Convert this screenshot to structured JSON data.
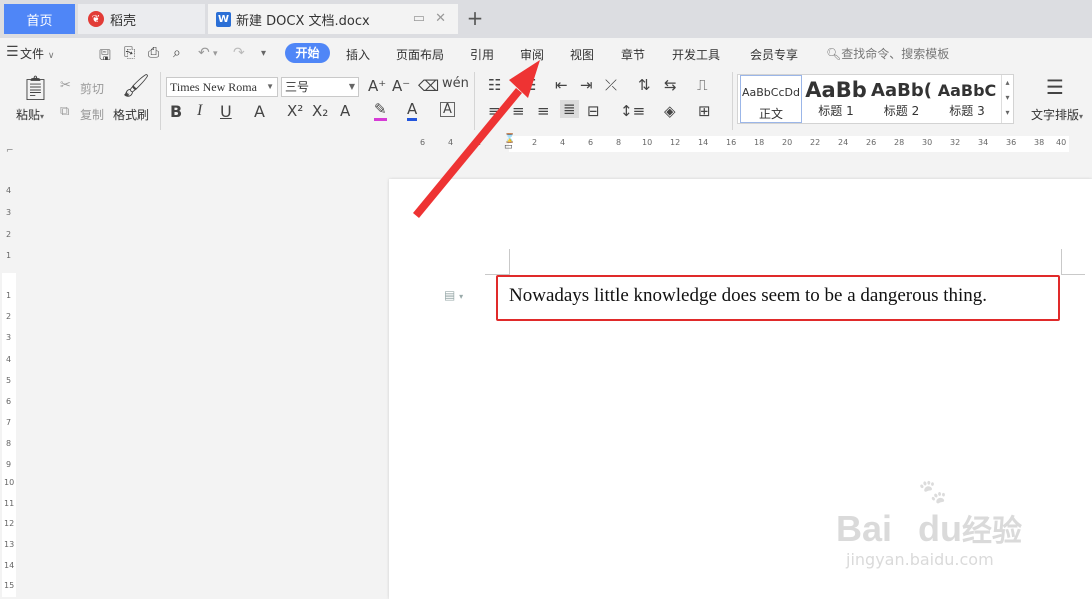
{
  "tabs": {
    "home": "首页",
    "docer": "稻壳",
    "doc": "新建 DOCX 文档.docx",
    "new_tab": "+"
  },
  "menu": {
    "file": "文件",
    "start": "开始",
    "insert": "插入",
    "layout": "页面布局",
    "references": "引用",
    "review": "审阅",
    "view": "视图",
    "chapter": "章节",
    "developer": "开发工具",
    "member": "会员专享",
    "search": "查找命令、搜索模板"
  },
  "ribbon": {
    "paste": "粘贴",
    "cut": "剪切",
    "copy": "复制",
    "format_painter": "格式刷",
    "font_name": "Times New Roma",
    "font_size": "三号",
    "text_layout": "文字排版",
    "styles": [
      {
        "sample": "AaBbCcDd",
        "name": "正文"
      },
      {
        "sample": "AaBb",
        "name": "标题 1"
      },
      {
        "sample": "AaBb(",
        "name": "标题 2"
      },
      {
        "sample": "AaBbC",
        "name": "标题 3"
      }
    ]
  },
  "ruler": {
    "h_left": [
      "6",
      "4",
      "2"
    ],
    "h_right": [
      "2",
      "4",
      "6",
      "8",
      "10",
      "12",
      "14",
      "16",
      "18",
      "20",
      "22",
      "24",
      "26",
      "28",
      "30",
      "32",
      "34",
      "36",
      "38",
      "40"
    ],
    "v": [
      "4",
      "3",
      "2",
      "1",
      "1",
      "2",
      "3",
      "4",
      "5",
      "6",
      "7",
      "8",
      "9",
      "10",
      "11",
      "12",
      "13",
      "14",
      "15"
    ]
  },
  "document": {
    "text": "Nowadays little knowledge does seem to be a dangerous thing."
  },
  "watermark": {
    "brand": "Bai",
    "brand2": "du",
    "cn": "经验",
    "url": "jingyan.baidu.com"
  },
  "colors": {
    "accent": "#4f86f7",
    "highlight": "#e02a2a",
    "arrow": "#ee3333"
  }
}
